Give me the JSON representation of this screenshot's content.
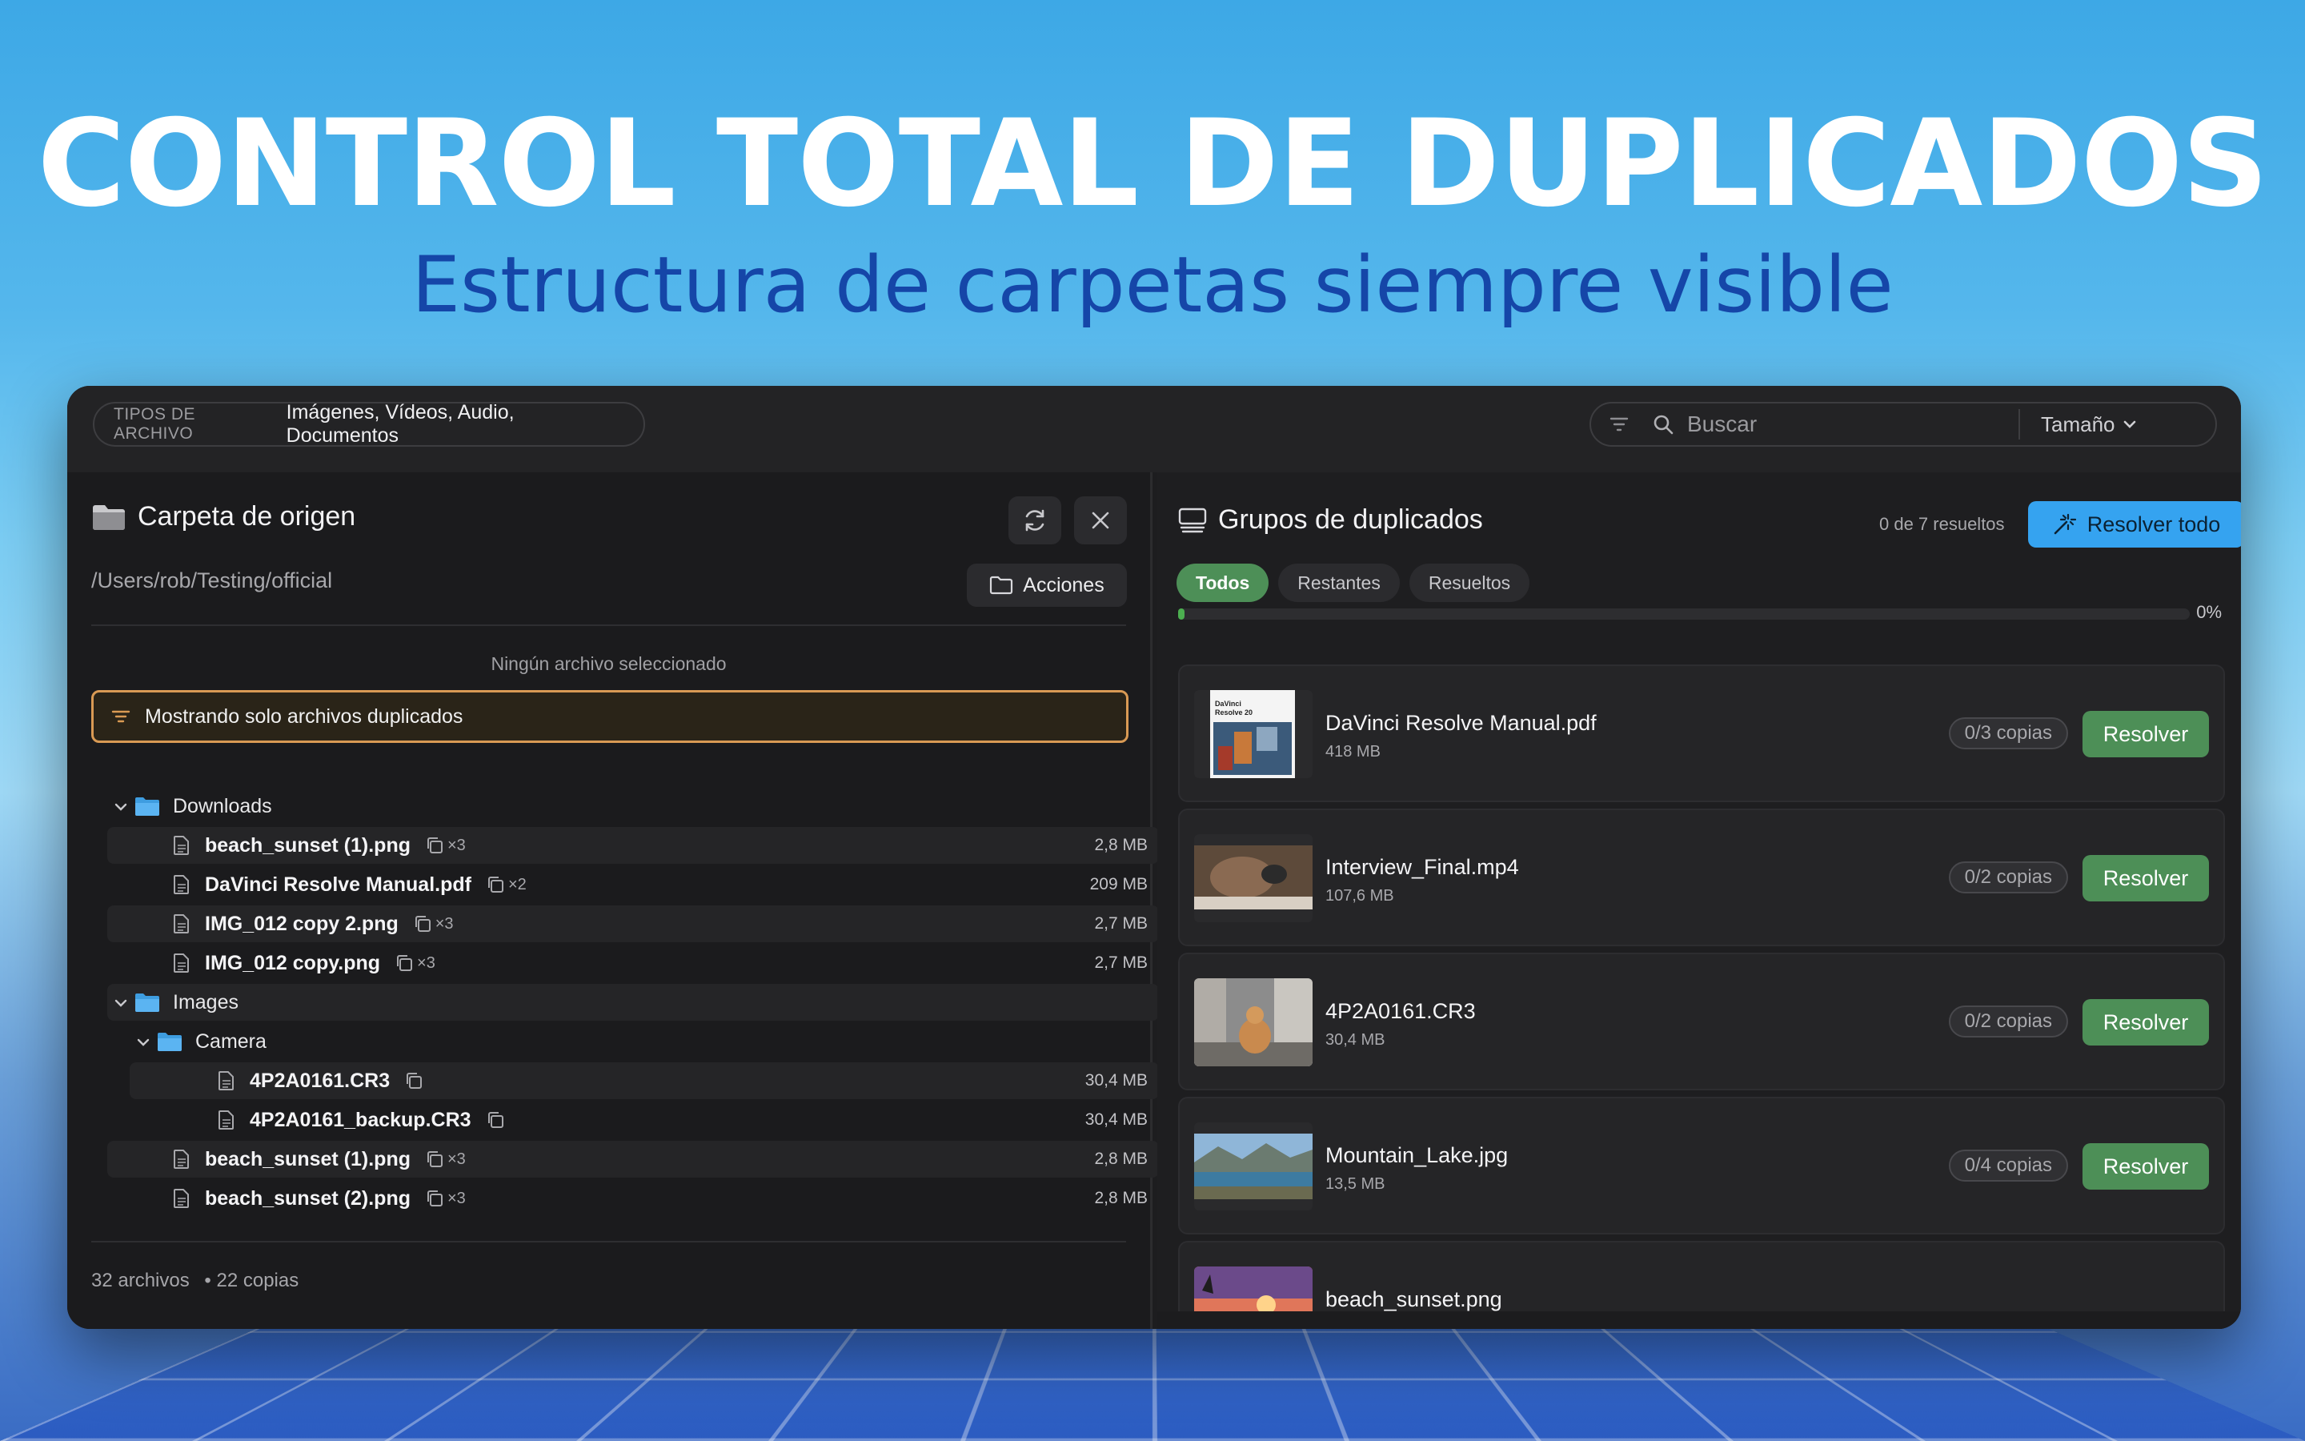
{
  "hero": {
    "title": "CONTROL TOTAL DE DUPLICADOS",
    "subtitle": "Estructura de carpetas siempre visible"
  },
  "toolbar": {
    "types_label": "TIPOS DE ARCHIVO",
    "types_value": "Imágenes, Vídeos, Audio, Documentos",
    "search_placeholder": "Buscar",
    "sort_label": "Tamaño"
  },
  "source": {
    "title": "Carpeta de origen",
    "path": "/Users/rob/Testing/official",
    "actions_label": "Acciones",
    "no_selection": "Ningún archivo seleccionado",
    "banner": "Mostrando solo archivos duplicados",
    "tree": [
      {
        "type": "folder",
        "name": "Downloads",
        "level": 0
      },
      {
        "type": "file",
        "name": "beach_sunset (1).png",
        "count": "×3",
        "size": "2,8 MB",
        "level": 1
      },
      {
        "type": "file",
        "name": "DaVinci Resolve Manual.pdf",
        "count": "×2",
        "size": "209 MB",
        "level": 1
      },
      {
        "type": "file",
        "name": "IMG_012 copy 2.png",
        "count": "×3",
        "size": "2,7 MB",
        "level": 1
      },
      {
        "type": "file",
        "name": "IMG_012 copy.png",
        "count": "×3",
        "size": "2,7 MB",
        "level": 1
      },
      {
        "type": "folder",
        "name": "Images",
        "level": 0
      },
      {
        "type": "folder",
        "name": "Camera",
        "level": 1
      },
      {
        "type": "file",
        "name": "4P2A0161.CR3",
        "count": "",
        "size": "30,4 MB",
        "level": 2
      },
      {
        "type": "file",
        "name": "4P2A0161_backup.CR3",
        "count": "",
        "size": "30,4 MB",
        "level": 2
      },
      {
        "type": "file",
        "name": "beach_sunset (1).png",
        "count": "×3",
        "size": "2,8 MB",
        "level": 1
      },
      {
        "type": "file",
        "name": "beach_sunset (2).png",
        "count": "×3",
        "size": "2,8 MB",
        "level": 1
      }
    ],
    "stats_files": "32 archivos",
    "stats_copies": "• 22 copias"
  },
  "groups": {
    "title": "Grupos de duplicados",
    "resolved_count": "0 de 7 resueltos",
    "resolve_all_label": "Resolver todo",
    "tabs": [
      "Todos",
      "Restantes",
      "Resueltos"
    ],
    "progress_pct": "0%",
    "progress_value": 0.005,
    "items": [
      {
        "name": "DaVinci Resolve Manual.pdf",
        "size": "418 MB",
        "copies": "0/3 copias",
        "action": "Resolver",
        "thumb": "pdf"
      },
      {
        "name": "Interview_Final.mp4",
        "size": "107,6 MB",
        "copies": "0/2 copias",
        "action": "Resolver",
        "thumb": "video"
      },
      {
        "name": "4P2A0161.CR3",
        "size": "30,4 MB",
        "copies": "0/2 copias",
        "action": "Resolver",
        "thumb": "cat"
      },
      {
        "name": "Mountain_Lake.jpg",
        "size": "13,5 MB",
        "copies": "0/4 copias",
        "action": "Resolver",
        "thumb": "lake"
      },
      {
        "name": "beach_sunset.png",
        "size": "",
        "copies": "",
        "action": "",
        "thumb": "sunset"
      }
    ]
  },
  "colors": {
    "accent_green": "#4d8f57",
    "accent_blue": "#35a3f0",
    "banner_border": "#d99a54",
    "folder_blue": "#5bb4f2"
  },
  "thumb_text": {
    "pdf_line1": "DaVinci",
    "pdf_line2": "Resolve 20"
  }
}
